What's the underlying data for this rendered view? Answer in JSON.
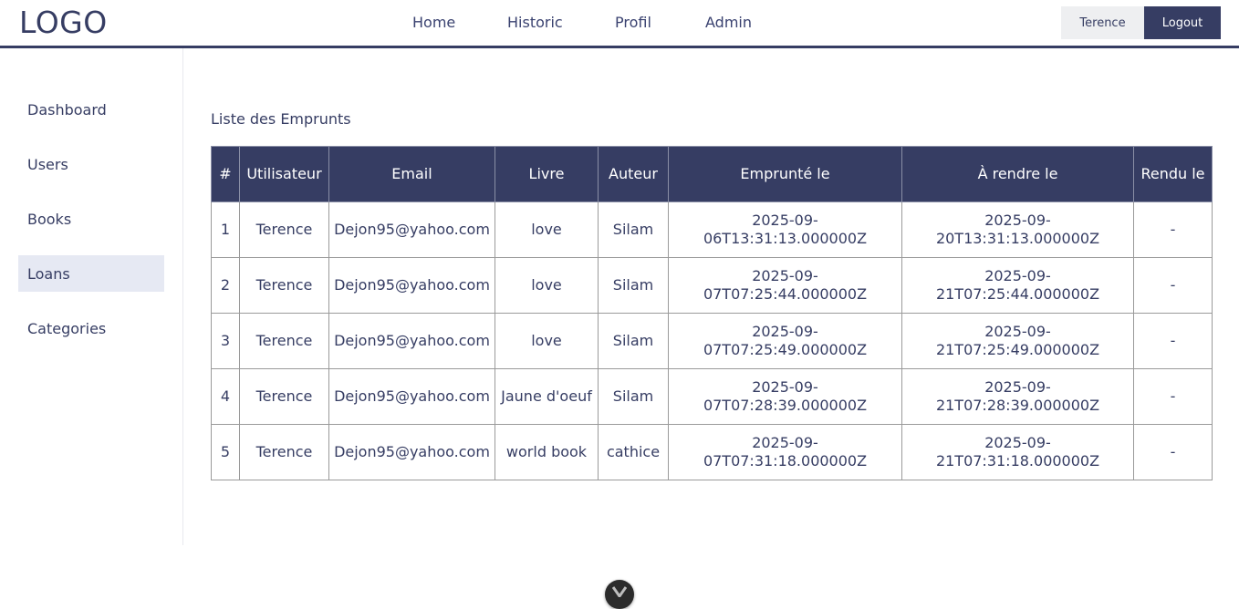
{
  "header": {
    "logo": "LOGO",
    "nav": [
      "Home",
      "Historic",
      "Profil",
      "Admin"
    ],
    "user": "Terence",
    "logout": "Logout"
  },
  "sidebar": {
    "items": [
      "Dashboard",
      "Users",
      "Books",
      "Loans",
      "Categories"
    ],
    "active": "Loans"
  },
  "main": {
    "title": "Liste des Emprunts",
    "table": {
      "headers": [
        "#",
        "Utilisateur",
        "Email",
        "Livre",
        "Auteur",
        "Emprunté le",
        "À rendre le",
        "Rendu le"
      ],
      "rows": [
        [
          "1",
          "Terence",
          "Dejon95@yahoo.com",
          "love",
          "Silam",
          "2025-09-06T13:31:13.000000Z",
          "2025-09-20T13:31:13.000000Z",
          "-"
        ],
        [
          "2",
          "Terence",
          "Dejon95@yahoo.com",
          "love",
          "Silam",
          "2025-09-07T07:25:44.000000Z",
          "2025-09-21T07:25:44.000000Z",
          "-"
        ],
        [
          "3",
          "Terence",
          "Dejon95@yahoo.com",
          "love",
          "Silam",
          "2025-09-07T07:25:49.000000Z",
          "2025-09-21T07:25:49.000000Z",
          "-"
        ],
        [
          "4",
          "Terence",
          "Dejon95@yahoo.com",
          "Jaune d'oeuf",
          "Silam",
          "2025-09-07T07:28:39.000000Z",
          "2025-09-21T07:28:39.000000Z",
          "-"
        ],
        [
          "5",
          "Terence",
          "Dejon95@yahoo.com",
          "world book",
          "cathice",
          "2025-09-07T07:31:18.000000Z",
          "2025-09-21T07:31:18.000000Z",
          "-"
        ]
      ]
    }
  },
  "colors": {
    "primary": "#363d63",
    "active_bg": "#e6e9f3",
    "user_bg": "#eeeff1"
  },
  "icons": {
    "scroll": "chevron-down-icon"
  }
}
